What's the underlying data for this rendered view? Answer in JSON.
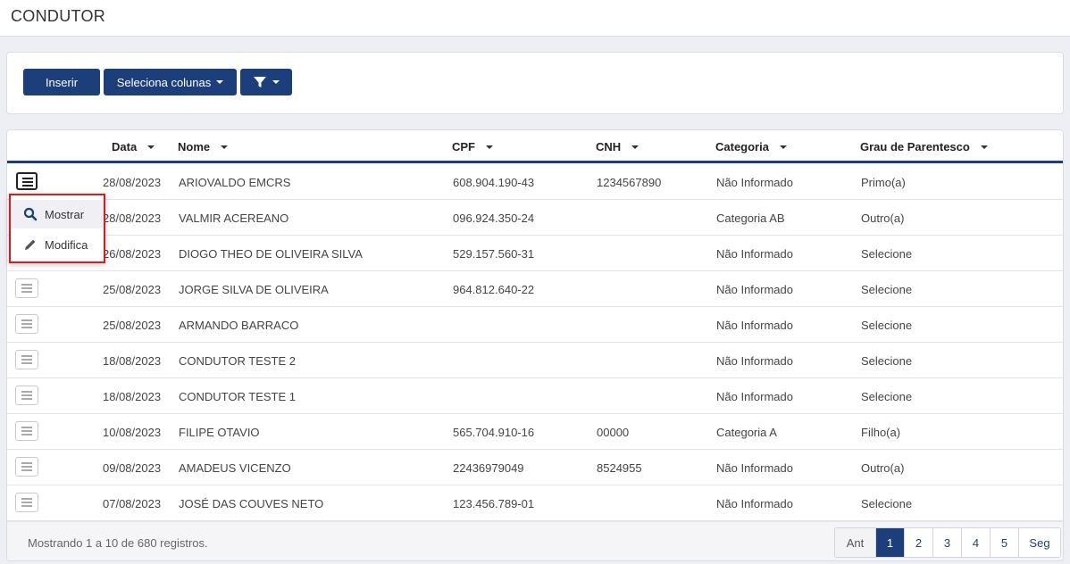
{
  "page": {
    "title": "CONDUTOR"
  },
  "toolbar": {
    "insert_label": "Inserir",
    "columns_label": "Seleciona colunas",
    "filter_icon": "filter-icon"
  },
  "table": {
    "columns": [
      "Data",
      "Nome",
      "CPF",
      "CNH",
      "Categoria",
      "Grau de Parentesco"
    ],
    "rows": [
      {
        "data": "28/08/2023",
        "nome": "ARIOVALDO EMCRS",
        "cpf": "608.904.190-43",
        "cnh": "1234567890",
        "categoria": "Não Informado",
        "grau": "Primo(a)"
      },
      {
        "data": "28/08/2023",
        "nome": "VALMIR ACEREANO",
        "cpf": "096.924.350-24",
        "cnh": "",
        "categoria": "Categoria AB",
        "grau": "Outro(a)"
      },
      {
        "data": "26/08/2023",
        "nome": "DIOGO THEO DE OLIVEIRA SILVA",
        "cpf": "529.157.560-31",
        "cnh": "",
        "categoria": "Não Informado",
        "grau": "Selecione"
      },
      {
        "data": "25/08/2023",
        "nome": "JORGE SILVA DE OLIVEIRA",
        "cpf": "964.812.640-22",
        "cnh": "",
        "categoria": "Não Informado",
        "grau": "Selecione"
      },
      {
        "data": "25/08/2023",
        "nome": "ARMANDO BARRACO",
        "cpf": "",
        "cnh": "",
        "categoria": "Não Informado",
        "grau": "Selecione"
      },
      {
        "data": "18/08/2023",
        "nome": "CONDUTOR TESTE 2",
        "cpf": "",
        "cnh": "",
        "categoria": "Não Informado",
        "grau": "Selecione"
      },
      {
        "data": "18/08/2023",
        "nome": "CONDUTOR TESTE 1",
        "cpf": "",
        "cnh": "",
        "categoria": "Não Informado",
        "grau": "Selecione"
      },
      {
        "data": "10/08/2023",
        "nome": "FILIPE OTAVIO",
        "cpf": "565.704.910-16",
        "cnh": "00000",
        "categoria": "Categoria A",
        "grau": "Filho(a)"
      },
      {
        "data": "09/08/2023",
        "nome": "AMADEUS VICENZO",
        "cpf": "22436979049",
        "cnh": "8524955",
        "categoria": "Não Informado",
        "grau": "Outro(a)"
      },
      {
        "data": "07/08/2023",
        "nome": "JOSÉ DAS COUVES NETO",
        "cpf": "123.456.789-01",
        "cnh": "",
        "categoria": "Não Informado",
        "grau": "Selecione"
      }
    ]
  },
  "row_menu": {
    "show_label": "Mostrar",
    "edit_label": "Modifica"
  },
  "footer": {
    "info": "Mostrando 1 a 10 de 680 registros.",
    "prev_label": "Ant",
    "next_label": "Seg",
    "pages": [
      "1",
      "2",
      "3",
      "4",
      "5"
    ],
    "current_page": "1"
  },
  "colors": {
    "primary": "#1c3f7c",
    "highlight_border": "#e0191e"
  }
}
